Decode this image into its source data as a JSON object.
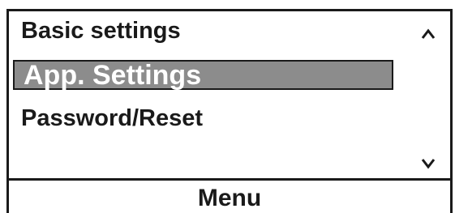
{
  "menu": {
    "items": [
      {
        "label": "Basic settings"
      },
      {
        "label": "App. Settings",
        "selected": true
      },
      {
        "label": "Password/Reset"
      }
    ],
    "scroll_up_icon": "caret-up-icon",
    "scroll_down_icon": "caret-down-icon",
    "scroll_up_symbol": "^",
    "scroll_down_symbol": "v"
  },
  "footer": {
    "label": "Menu"
  },
  "colors": {
    "selection_background": "#8c8c8c",
    "selection_text": "#ffffff",
    "foreground": "#1a1a1a",
    "background": "#ffffff"
  }
}
